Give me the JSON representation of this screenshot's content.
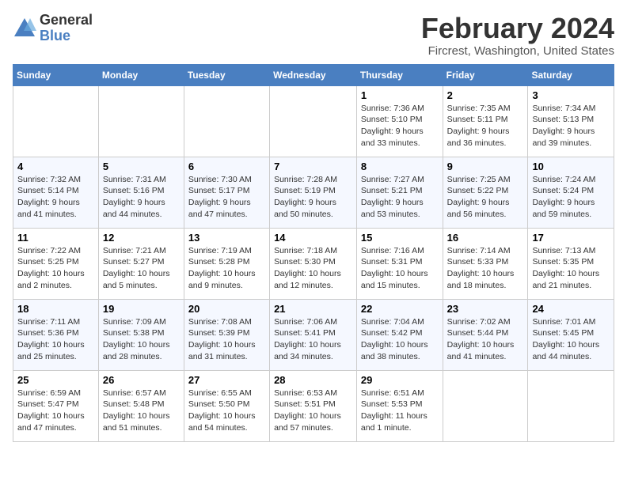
{
  "header": {
    "logo": {
      "general": "General",
      "blue": "Blue"
    },
    "month": "February 2024",
    "location": "Fircrest, Washington, United States"
  },
  "weekdays": [
    "Sunday",
    "Monday",
    "Tuesday",
    "Wednesday",
    "Thursday",
    "Friday",
    "Saturday"
  ],
  "weeks": [
    [
      {
        "day": "",
        "info": ""
      },
      {
        "day": "",
        "info": ""
      },
      {
        "day": "",
        "info": ""
      },
      {
        "day": "",
        "info": ""
      },
      {
        "day": "1",
        "info": "Sunrise: 7:36 AM\nSunset: 5:10 PM\nDaylight: 9 hours\nand 33 minutes."
      },
      {
        "day": "2",
        "info": "Sunrise: 7:35 AM\nSunset: 5:11 PM\nDaylight: 9 hours\nand 36 minutes."
      },
      {
        "day": "3",
        "info": "Sunrise: 7:34 AM\nSunset: 5:13 PM\nDaylight: 9 hours\nand 39 minutes."
      }
    ],
    [
      {
        "day": "4",
        "info": "Sunrise: 7:32 AM\nSunset: 5:14 PM\nDaylight: 9 hours\nand 41 minutes."
      },
      {
        "day": "5",
        "info": "Sunrise: 7:31 AM\nSunset: 5:16 PM\nDaylight: 9 hours\nand 44 minutes."
      },
      {
        "day": "6",
        "info": "Sunrise: 7:30 AM\nSunset: 5:17 PM\nDaylight: 9 hours\nand 47 minutes."
      },
      {
        "day": "7",
        "info": "Sunrise: 7:28 AM\nSunset: 5:19 PM\nDaylight: 9 hours\nand 50 minutes."
      },
      {
        "day": "8",
        "info": "Sunrise: 7:27 AM\nSunset: 5:21 PM\nDaylight: 9 hours\nand 53 minutes."
      },
      {
        "day": "9",
        "info": "Sunrise: 7:25 AM\nSunset: 5:22 PM\nDaylight: 9 hours\nand 56 minutes."
      },
      {
        "day": "10",
        "info": "Sunrise: 7:24 AM\nSunset: 5:24 PM\nDaylight: 9 hours\nand 59 minutes."
      }
    ],
    [
      {
        "day": "11",
        "info": "Sunrise: 7:22 AM\nSunset: 5:25 PM\nDaylight: 10 hours\nand 2 minutes."
      },
      {
        "day": "12",
        "info": "Sunrise: 7:21 AM\nSunset: 5:27 PM\nDaylight: 10 hours\nand 5 minutes."
      },
      {
        "day": "13",
        "info": "Sunrise: 7:19 AM\nSunset: 5:28 PM\nDaylight: 10 hours\nand 9 minutes."
      },
      {
        "day": "14",
        "info": "Sunrise: 7:18 AM\nSunset: 5:30 PM\nDaylight: 10 hours\nand 12 minutes."
      },
      {
        "day": "15",
        "info": "Sunrise: 7:16 AM\nSunset: 5:31 PM\nDaylight: 10 hours\nand 15 minutes."
      },
      {
        "day": "16",
        "info": "Sunrise: 7:14 AM\nSunset: 5:33 PM\nDaylight: 10 hours\nand 18 minutes."
      },
      {
        "day": "17",
        "info": "Sunrise: 7:13 AM\nSunset: 5:35 PM\nDaylight: 10 hours\nand 21 minutes."
      }
    ],
    [
      {
        "day": "18",
        "info": "Sunrise: 7:11 AM\nSunset: 5:36 PM\nDaylight: 10 hours\nand 25 minutes."
      },
      {
        "day": "19",
        "info": "Sunrise: 7:09 AM\nSunset: 5:38 PM\nDaylight: 10 hours\nand 28 minutes."
      },
      {
        "day": "20",
        "info": "Sunrise: 7:08 AM\nSunset: 5:39 PM\nDaylight: 10 hours\nand 31 minutes."
      },
      {
        "day": "21",
        "info": "Sunrise: 7:06 AM\nSunset: 5:41 PM\nDaylight: 10 hours\nand 34 minutes."
      },
      {
        "day": "22",
        "info": "Sunrise: 7:04 AM\nSunset: 5:42 PM\nDaylight: 10 hours\nand 38 minutes."
      },
      {
        "day": "23",
        "info": "Sunrise: 7:02 AM\nSunset: 5:44 PM\nDaylight: 10 hours\nand 41 minutes."
      },
      {
        "day": "24",
        "info": "Sunrise: 7:01 AM\nSunset: 5:45 PM\nDaylight: 10 hours\nand 44 minutes."
      }
    ],
    [
      {
        "day": "25",
        "info": "Sunrise: 6:59 AM\nSunset: 5:47 PM\nDaylight: 10 hours\nand 47 minutes."
      },
      {
        "day": "26",
        "info": "Sunrise: 6:57 AM\nSunset: 5:48 PM\nDaylight: 10 hours\nand 51 minutes."
      },
      {
        "day": "27",
        "info": "Sunrise: 6:55 AM\nSunset: 5:50 PM\nDaylight: 10 hours\nand 54 minutes."
      },
      {
        "day": "28",
        "info": "Sunrise: 6:53 AM\nSunset: 5:51 PM\nDaylight: 10 hours\nand 57 minutes."
      },
      {
        "day": "29",
        "info": "Sunrise: 6:51 AM\nSunset: 5:53 PM\nDaylight: 11 hours\nand 1 minute."
      },
      {
        "day": "",
        "info": ""
      },
      {
        "day": "",
        "info": ""
      }
    ]
  ]
}
